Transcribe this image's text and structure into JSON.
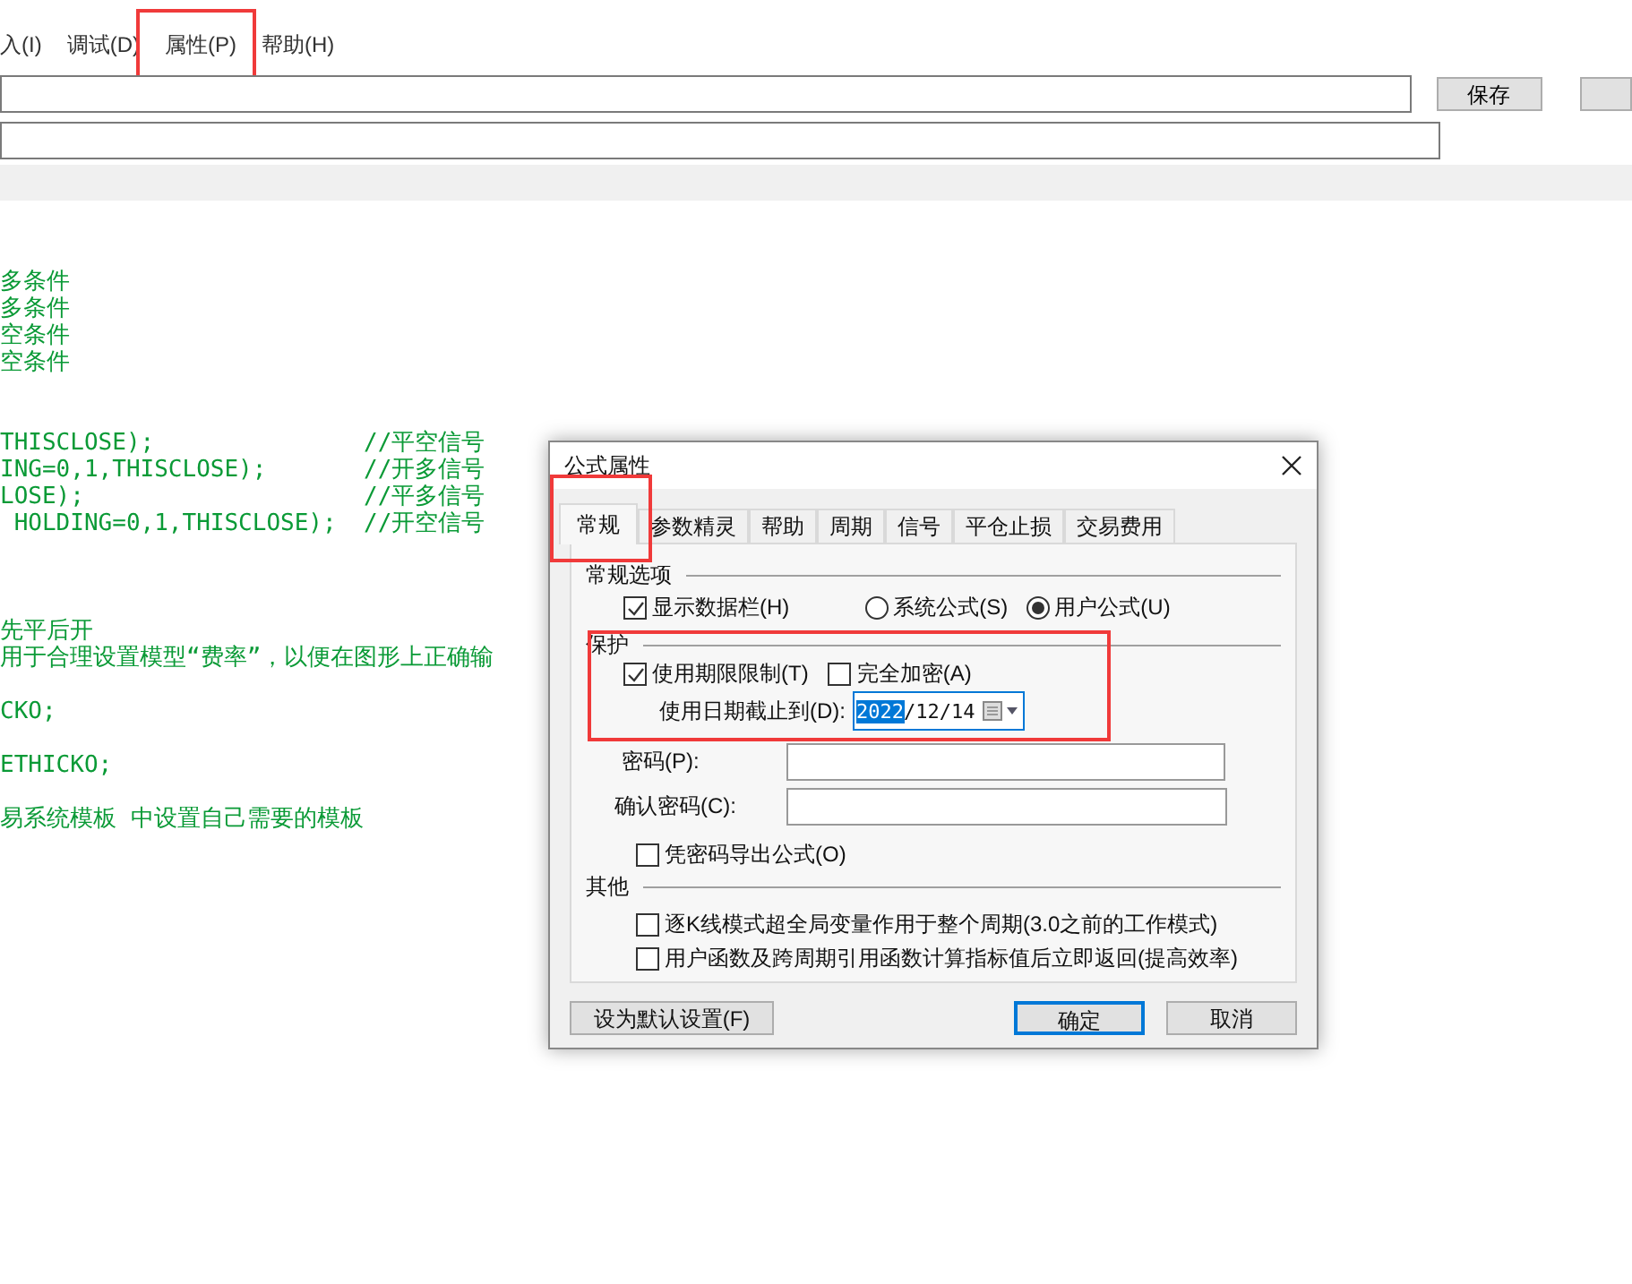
{
  "menu": [
    {
      "label": "入(I)",
      "highlighted": false
    },
    {
      "label": "调试(D)",
      "highlighted": false
    },
    {
      "label": "属性(P)",
      "highlighted": true
    },
    {
      "label": "帮助(H)",
      "highlighted": false
    }
  ],
  "toolbar": {
    "save_button": "保存"
  },
  "code_lines": [
    {
      "kind": "blank"
    },
    {
      "kind": "blank"
    },
    {
      "kind": "text",
      "text": "多条件"
    },
    {
      "kind": "text",
      "text": "多条件"
    },
    {
      "kind": "text",
      "text": "空条件"
    },
    {
      "kind": "text",
      "text": "空条件"
    },
    {
      "kind": "blank"
    },
    {
      "kind": "blank"
    },
    {
      "kind": "text",
      "text": "THISCLOSE);",
      "comment": "//平空信号"
    },
    {
      "kind": "text",
      "text": "ING=0,1,THISCLOSE);",
      "comment": "//开多信号"
    },
    {
      "kind": "text",
      "text": "LOSE);",
      "comment": "//平多信号"
    },
    {
      "kind": "text",
      "text": " HOLDING=0,1,THISCLOSE);",
      "comment": "//开空信号"
    },
    {
      "kind": "blank"
    },
    {
      "kind": "blank"
    },
    {
      "kind": "blank"
    },
    {
      "kind": "text",
      "text": "先平后开"
    },
    {
      "kind": "text",
      "text": "用于合理设置模型“费率”，以便在图形上正确输"
    },
    {
      "kind": "blank"
    },
    {
      "kind": "text",
      "text": "CKO;"
    },
    {
      "kind": "blank"
    },
    {
      "kind": "text",
      "text": "ETHICKO;"
    },
    {
      "kind": "blank"
    },
    {
      "kind": "text",
      "text": "易系统模板 中设置自己需要的模板"
    }
  ],
  "dialog": {
    "title": "公式属性",
    "tabs": [
      {
        "label": "常规",
        "selected": true,
        "highlighted": true
      },
      {
        "label": "参数精灵",
        "selected": false,
        "highlighted": false
      },
      {
        "label": "帮助",
        "selected": false,
        "highlighted": false
      },
      {
        "label": "周期",
        "selected": false,
        "highlighted": false
      },
      {
        "label": "信号",
        "selected": false,
        "highlighted": false
      },
      {
        "label": "平仓止损",
        "selected": false,
        "highlighted": false
      },
      {
        "label": "交易费用",
        "selected": false,
        "highlighted": false
      }
    ],
    "general": {
      "title": "常规选项",
      "show_data_bar": {
        "label": "显示数据栏(H)",
        "checked": true
      },
      "formula_types": [
        {
          "label": "系统公式(S)",
          "selected": false
        },
        {
          "label": "用户公式(U)",
          "selected": true
        }
      ]
    },
    "protection": {
      "title": "保护",
      "highlighted": true,
      "checkboxes": [
        {
          "label": "使用期限限制(T)",
          "checked": true
        },
        {
          "label": "完全加密(A)",
          "checked": false
        }
      ],
      "date_label": "使用日期截止到(D):",
      "date_selected_part": "2022",
      "date_rest": "/12/14",
      "password_label": "密码(P):",
      "confirm_label": "确认密码(C):",
      "export": {
        "label": "凭密码导出公式(O)",
        "checked": false
      }
    },
    "other": {
      "title": "其他",
      "checkboxes": [
        {
          "label": "逐K线模式超全局变量作用于整个周期(3.0之前的工作模式)",
          "checked": false
        },
        {
          "label": "用户函数及跨周期引用函数计算指标值后立即返回(提高效率)",
          "checked": false
        }
      ]
    },
    "buttons": [
      {
        "label": "设为默认设置(F)",
        "kind": "left",
        "default": false
      },
      {
        "label": "确定",
        "kind": "right",
        "default": true
      },
      {
        "label": "取消",
        "kind": "right",
        "default": false
      }
    ]
  }
}
